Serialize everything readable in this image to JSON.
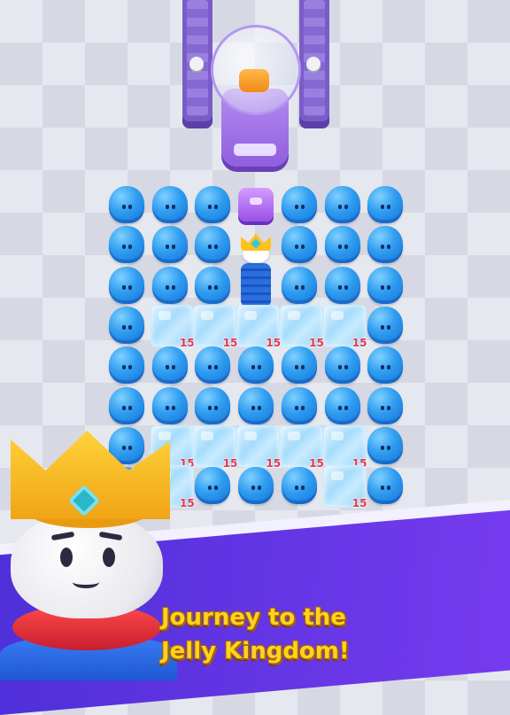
{
  "tagline": {
    "line1": "Journey to the",
    "line2": "Jelly Kingdom!"
  },
  "board": {
    "ice_count": "15",
    "rows": [
      [
        "jelly",
        "jelly",
        "jelly",
        "purple",
        "jelly",
        "jelly",
        "jelly"
      ],
      [
        "jelly",
        "jelly",
        "jelly",
        "king",
        "jelly",
        "jelly",
        "jelly"
      ],
      [
        "jelly",
        "jelly",
        "jelly",
        "king2",
        "jelly",
        "jelly",
        "jelly"
      ],
      [
        "jelly",
        "ice",
        "ice",
        "ice",
        "ice",
        "ice",
        "jelly"
      ],
      [
        "jelly",
        "jelly",
        "jelly",
        "jelly",
        "jelly",
        "jelly",
        "jelly"
      ],
      [
        "jelly",
        "jelly",
        "jelly",
        "jelly",
        "jelly",
        "jelly",
        "jelly"
      ],
      [
        "jelly",
        "ice",
        "ice",
        "ice",
        "ice",
        "ice",
        "jelly"
      ],
      [
        "jelly",
        "ice",
        "jelly",
        "jelly",
        "jelly",
        "ice",
        "jelly"
      ]
    ]
  },
  "colors": {
    "jelly": "#2e9cf0",
    "ice_count": "#e8354a",
    "banner": "#5b34e0",
    "tagline": "#ffd21e"
  },
  "icons": {
    "king": "crowned-king-character",
    "block": "purple-block-icon"
  }
}
